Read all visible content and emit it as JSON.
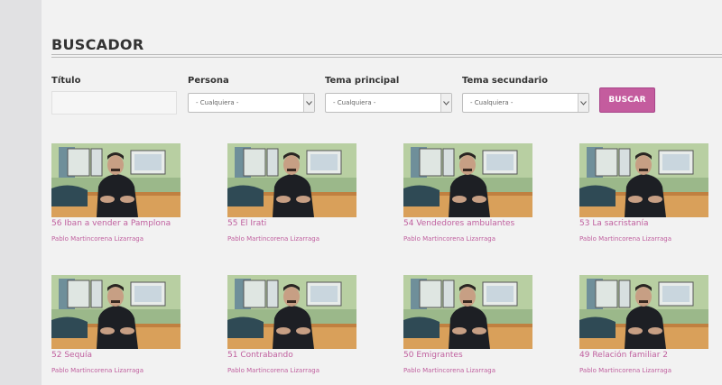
{
  "header": {
    "title": "BUSCADOR"
  },
  "filters": {
    "titulo_label": "Título",
    "titulo_value": "",
    "persona_label": "Persona",
    "persona_value": "- Cualquiera -",
    "tema_principal_label": "Tema principal",
    "tema_principal_value": "- Cualquiera -",
    "tema_secundario_label": "Tema secundario",
    "tema_secundario_value": "- Cualquiera -",
    "search_label": "BUSCAR"
  },
  "results": [
    {
      "title": "56 Iban a vender a Pamplona",
      "author": "Pablo Martincorena Lizarraga"
    },
    {
      "title": "55 El Irati",
      "author": "Pablo Martincorena Lizarraga"
    },
    {
      "title": "54 Vendedores ambulantes",
      "author": "Pablo Martincorena Lizarraga"
    },
    {
      "title": "53 La sacristanía",
      "author": "Pablo Martincorena Lizarraga"
    },
    {
      "title": "52 Sequía",
      "author": "Pablo Martincorena Lizarraga"
    },
    {
      "title": "51 Contrabando",
      "author": "Pablo Martincorena Lizarraga"
    },
    {
      "title": "50 Emigrantes",
      "author": "Pablo Martincorena Lizarraga"
    },
    {
      "title": "49 Relación familiar 2",
      "author": "Pablo Martincorena Lizarraga"
    }
  ],
  "colors": {
    "accent": "#c45c9e",
    "link": "#c0609f"
  }
}
